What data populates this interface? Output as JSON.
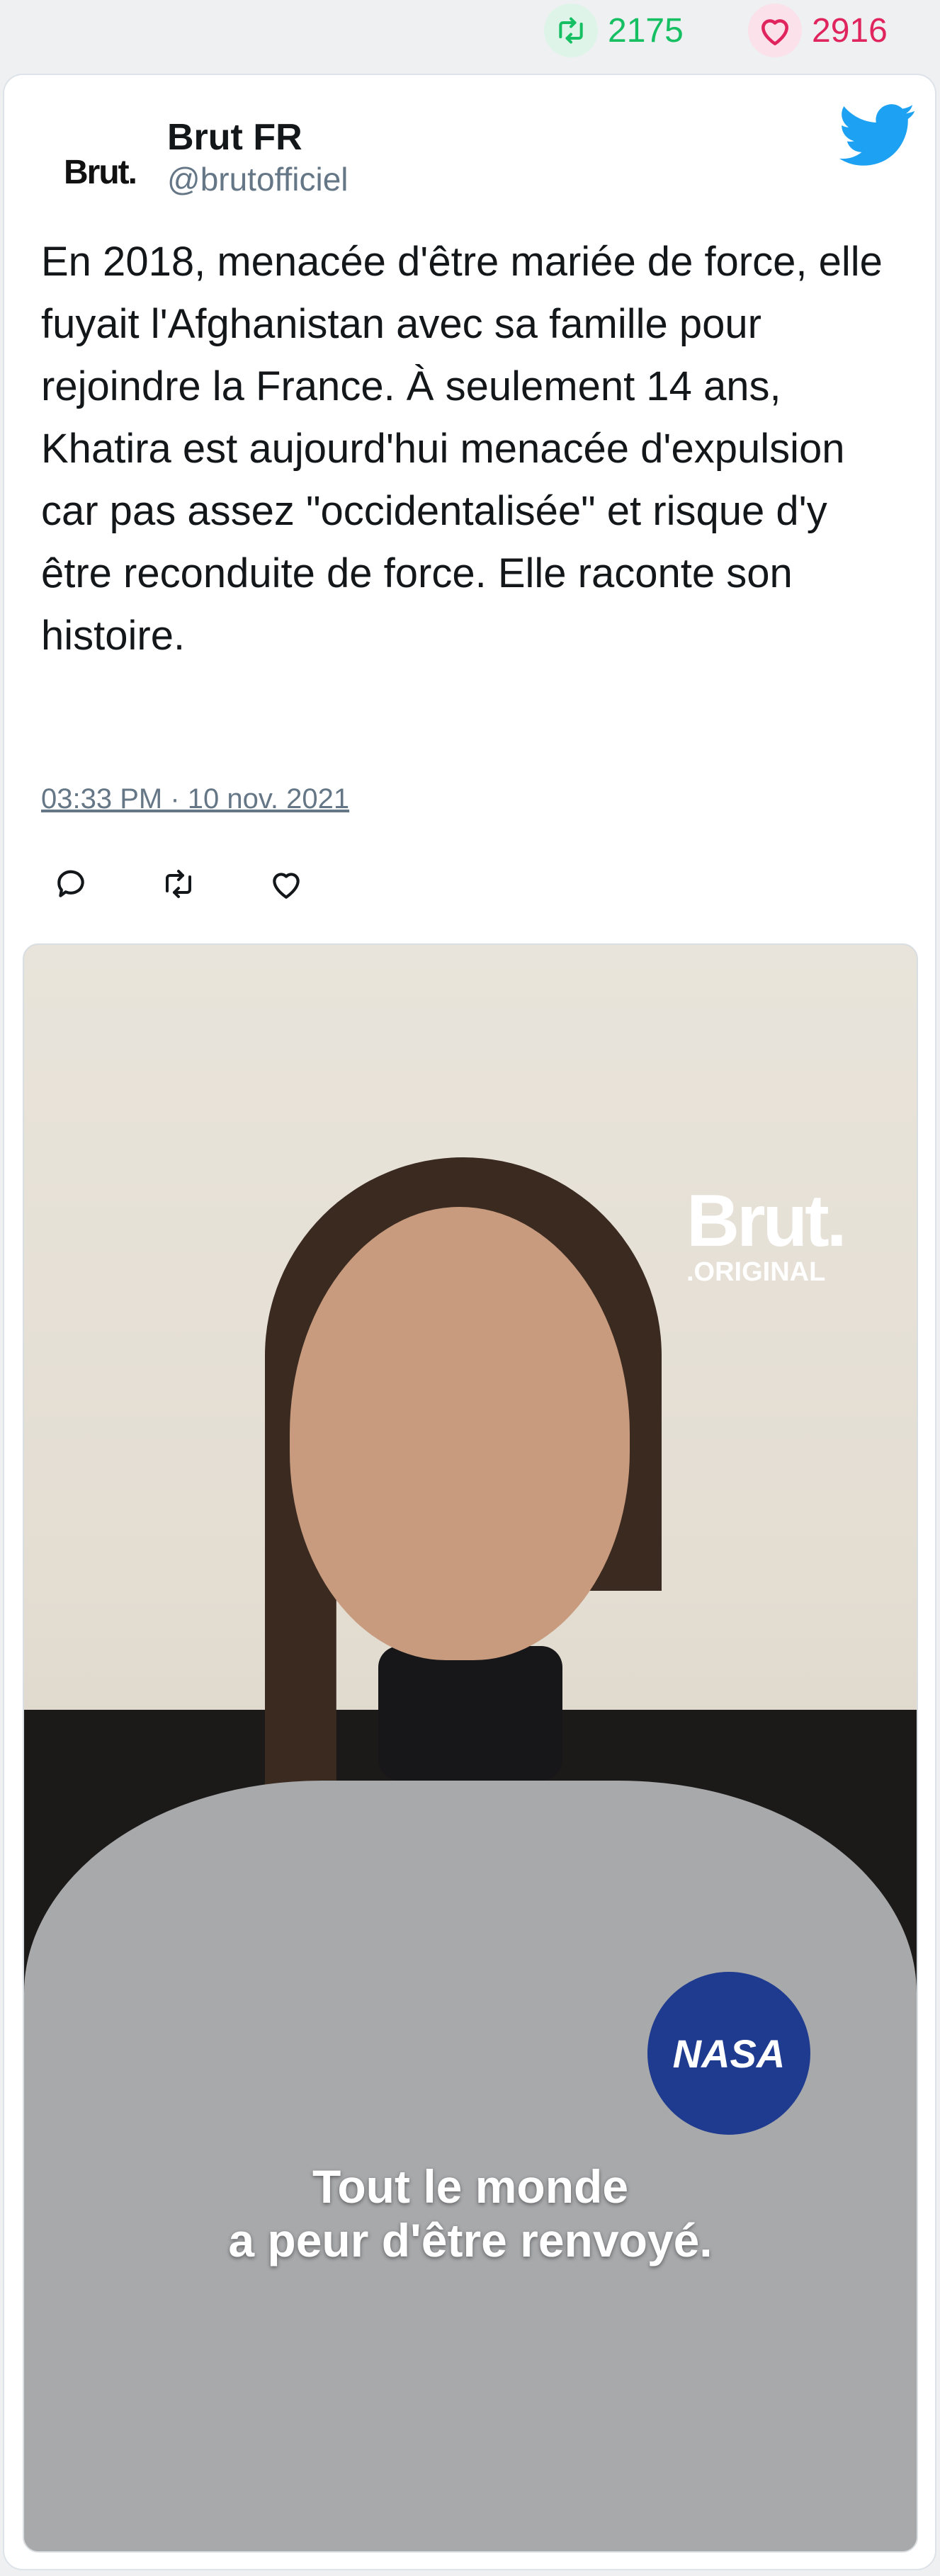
{
  "stats": {
    "retweets": "2175",
    "likes": "2916",
    "retweet_color": "#17bf63",
    "like_color": "#e0245e"
  },
  "tweet": {
    "avatar_text": "Brut.",
    "author_name": "Brut FR",
    "handle": "@brutofficiel",
    "text": "En 2018, menacée d'être mariée de force, elle fuyait l'Afghanistan avec sa famille pour rejoindre la France. À seulement 14 ans, Khatira est aujourd'hui menacée d'expulsion car pas assez \"occidentalisée\" et risque d'y être reconduite de force. Elle raconte son histoire.",
    "timestamp": "03:33 PM · 10 nov. 2021",
    "brand_icon": "twitter-bird-icon",
    "brand_color": "#1da1f2"
  },
  "media": {
    "watermark_main": "Brut.",
    "watermark_sub": ".ORIGINAL",
    "sweater_logo": "NASA",
    "caption_line1": "Tout le monde",
    "caption_line2": "a peur d'être renvoyé."
  },
  "actions": [
    "reply-icon",
    "retweet-icon",
    "like-icon"
  ]
}
